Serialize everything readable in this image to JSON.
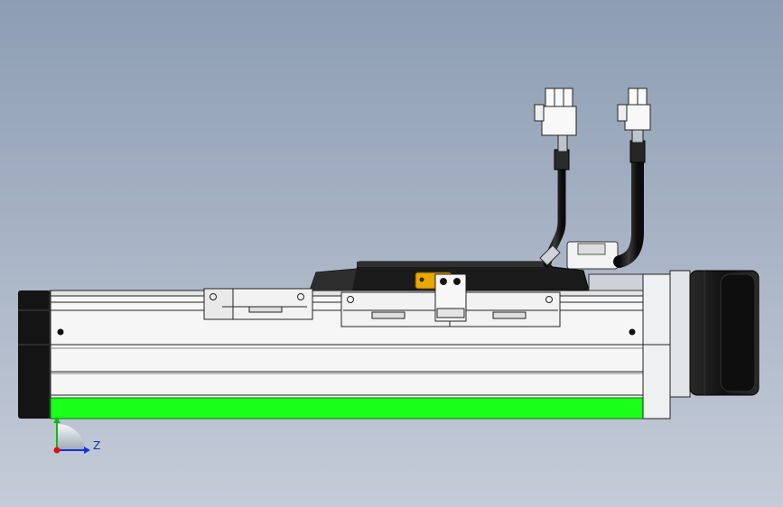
{
  "viewport": {
    "background_top": "#8d9db3",
    "background_bottom": "#c5ccd8"
  },
  "model": {
    "highlight_color": "#19ff19",
    "rail_color": "#f4f4f4",
    "motor_color": "#161616",
    "bracket_color": "#e8a800"
  },
  "triad": {
    "z_label": "Z",
    "x_color": "#1433d9",
    "y_color": "#12b812",
    "origin_color": "#e01010"
  }
}
